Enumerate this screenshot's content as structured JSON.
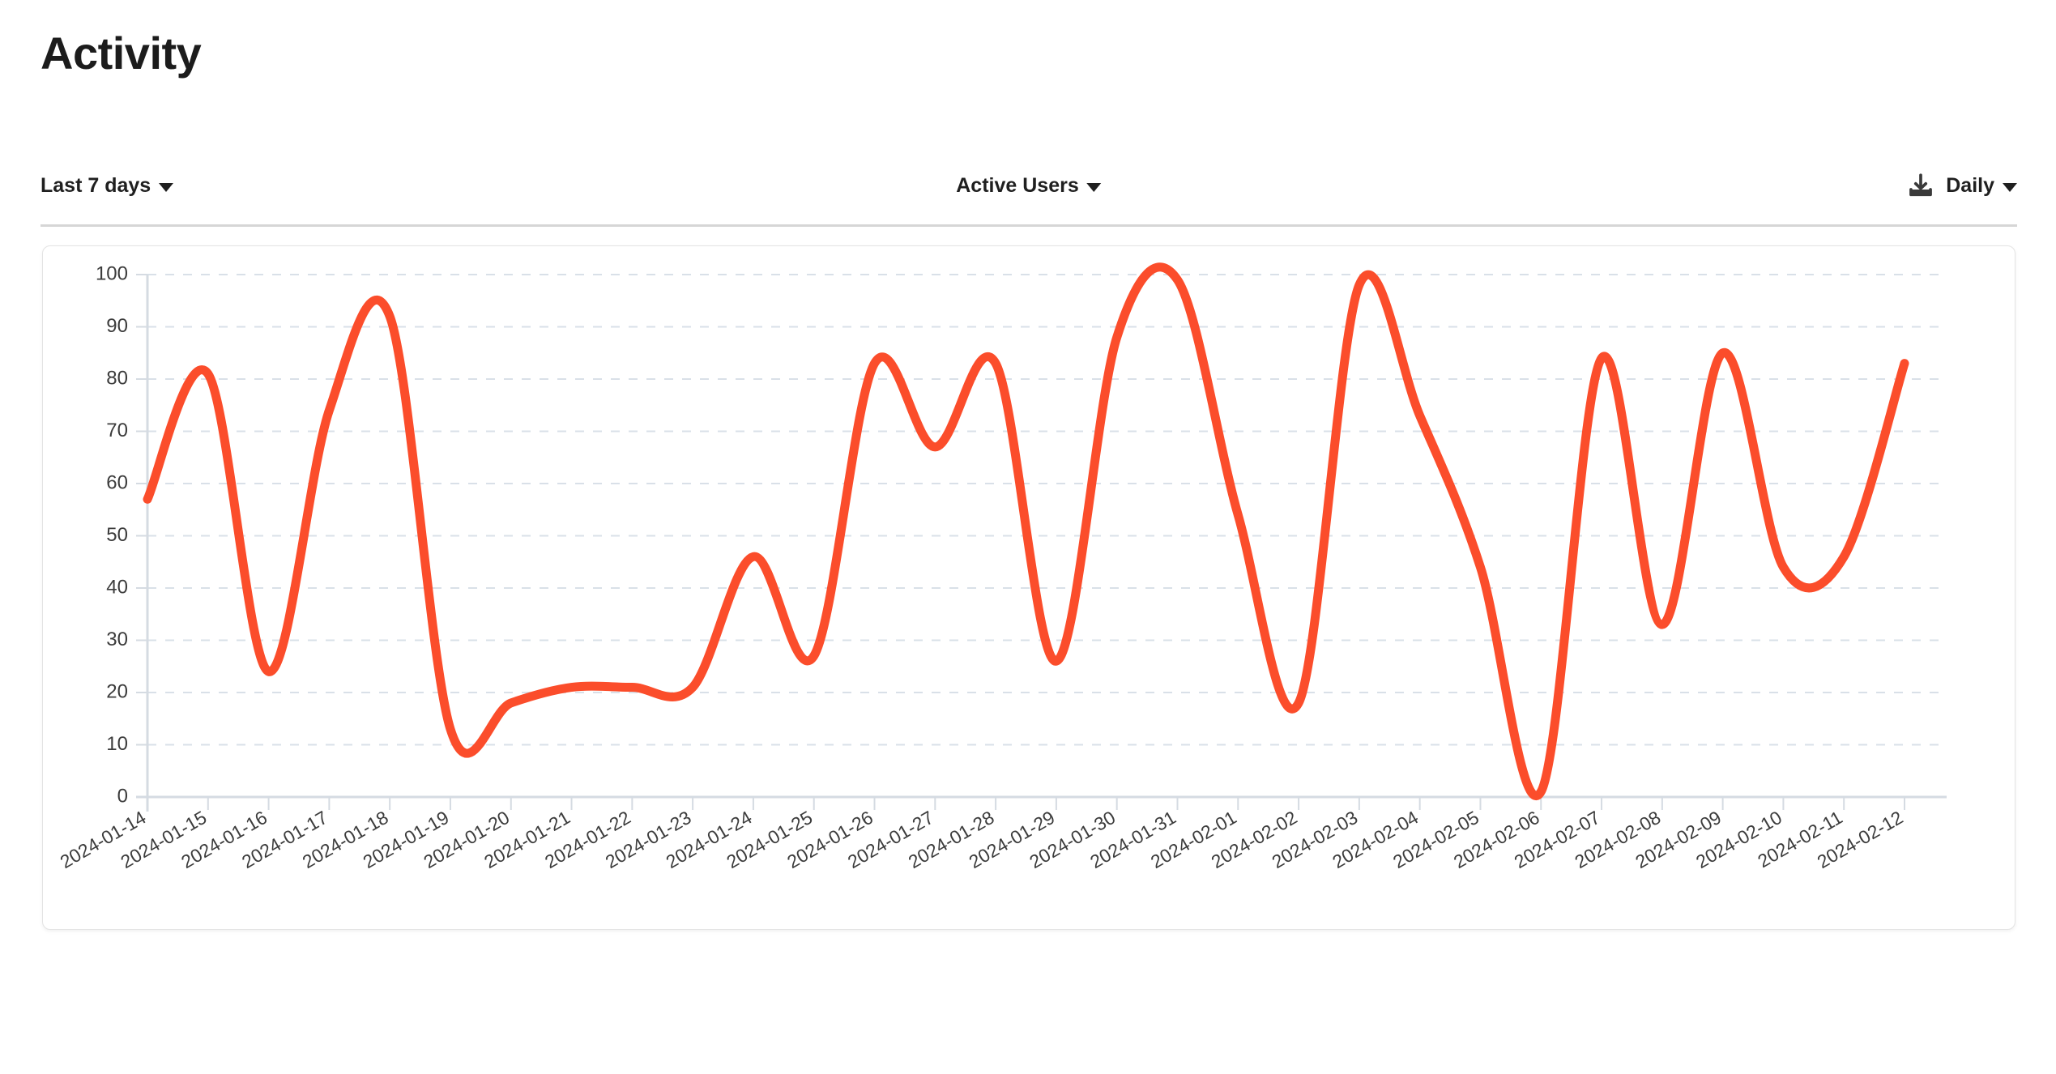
{
  "page": {
    "title": "Activity"
  },
  "controls": {
    "range": {
      "label": "Last 7 days",
      "caret": "chevron-down-icon"
    },
    "metric": {
      "label": "Active Users",
      "caret": "chevron-down-icon"
    },
    "download": {
      "icon": "download-icon"
    },
    "granularity": {
      "label": "Daily",
      "caret": "chevron-down-icon"
    }
  },
  "colors": {
    "line": "#fb4d2b",
    "grid": "#d9e0e8",
    "axis": "#d5dbe2",
    "card_border": "#e3e3e3",
    "divider": "#d6d6d6",
    "text": "#3c3c3c"
  },
  "chart_data": {
    "type": "line",
    "title": "Active Users",
    "xlabel": "",
    "ylabel": "",
    "ylim": [
      0,
      100
    ],
    "yticks": [
      0,
      10,
      20,
      30,
      40,
      50,
      60,
      70,
      80,
      90,
      100
    ],
    "grid": true,
    "legend": null,
    "smoothing": "monotone-spline",
    "series": [
      {
        "name": "Active Users",
        "color": "#fb4d2b",
        "values": [
          57,
          81,
          24,
          74,
          92,
          13,
          18,
          21,
          21,
          21,
          46,
          27,
          83,
          67,
          83,
          26,
          88,
          99,
          54,
          18,
          98,
          73,
          44,
          1,
          84,
          33,
          85,
          44,
          46,
          83
        ]
      }
    ],
    "categories": [
      "2024-01-14",
      "2024-01-15",
      "2024-01-16",
      "2024-01-17",
      "2024-01-18",
      "2024-01-19",
      "2024-01-20",
      "2024-01-21",
      "2024-01-22",
      "2024-01-23",
      "2024-01-24",
      "2024-01-25",
      "2024-01-26",
      "2024-01-27",
      "2024-01-28",
      "2024-01-29",
      "2024-01-30",
      "2024-01-31",
      "2024-02-01",
      "2024-02-02",
      "2024-02-03",
      "2024-02-04",
      "2024-02-05",
      "2024-02-06",
      "2024-02-07",
      "2024-02-08",
      "2024-02-09",
      "2024-02-10",
      "2024-02-11",
      "2024-02-12"
    ]
  }
}
